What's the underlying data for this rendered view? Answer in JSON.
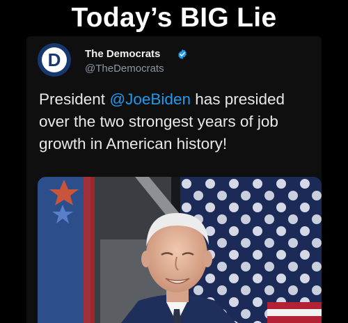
{
  "meme": {
    "title": "Today’s BIG Lie"
  },
  "account": {
    "name": "The Democrats",
    "handle": "@TheDemocrats",
    "avatar_letter": "D",
    "avatar_icon": "democrats-logo-icon",
    "verified_icon": "verified-badge-icon"
  },
  "tweet": {
    "text_before": "President ",
    "mention": "@JoeBiden",
    "text_after": " has presided over the two strongest years of job growth in American history!"
  },
  "media": {
    "description_icon": "photo-joe-biden-flag-background"
  },
  "colors": {
    "background": "#000000",
    "mention": "#1d9bf0",
    "handle": "#8b98a5",
    "verified": "#1d9bf0",
    "avatar": "#17386f"
  }
}
